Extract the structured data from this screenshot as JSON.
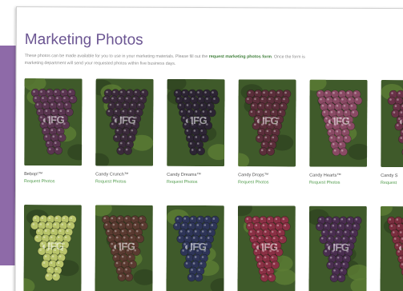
{
  "page": {
    "title": "Marketing Photos",
    "intro_line1_before": "These photos can be made available for you to use in your marketing materials. Please fill out the ",
    "intro_link": "request marketing photos form",
    "intro_line1_after": ". Once the form is",
    "intro_line2": "marketing department will send your requested photos within five business days."
  },
  "watermark": "IFG",
  "varieties": [
    {
      "name": "Bebop!™",
      "request": "Request Photos",
      "color": "#5a3550"
    },
    {
      "name": "Candy Crunch™",
      "request": "Request Photos",
      "color": "#3a2a3a"
    },
    {
      "name": "Candy Dreams™",
      "request": "Request Photos",
      "color": "#2c2433"
    },
    {
      "name": "Candy Drops™",
      "request": "Request Photos",
      "color": "#5b2e3a"
    },
    {
      "name": "Candy Hearts™",
      "request": "Request Photos",
      "color": "#8a4a64"
    },
    {
      "name": "Candy S",
      "request": "Request",
      "color": "#6a3248"
    }
  ],
  "row2_colors": [
    "#b8c46a",
    "#5a3a30",
    "#2e3558",
    "#8a3044",
    "#4a2e50",
    "#7a2e3e"
  ]
}
